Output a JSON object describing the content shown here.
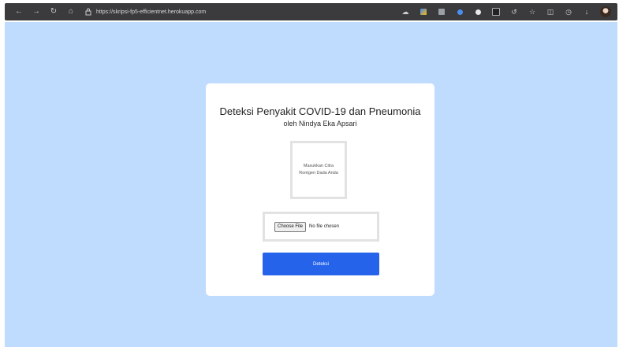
{
  "browser": {
    "url": "https://skripsi-fp5-efficientnet.herokuapp.com",
    "icons": [
      "back-icon",
      "forward-icon",
      "reload-icon",
      "home-icon",
      "lock-icon"
    ],
    "extension_icons": [
      "cast-icon",
      "extension-colorful-icon",
      "extension-icon",
      "extension-blue-icon",
      "extension-white-icon",
      "extension-square-icon",
      "refresh-extension-icon",
      "star-icon",
      "collections-icon",
      "history-icon",
      "download-icon",
      "profile-avatar"
    ]
  },
  "page": {
    "background": "#bfdbfe",
    "title": "Deteksi Penyakit COVID-19 dan Pneumonia",
    "subtitle": "oleh Nindya Eka Apsari",
    "image_placeholder": "Masukkan Citra Rontgen Dada Anda",
    "file_input": {
      "button_label": "Choose File",
      "status": "No file chosen"
    },
    "submit_label": "Deteksi",
    "accent": "#2563eb"
  }
}
